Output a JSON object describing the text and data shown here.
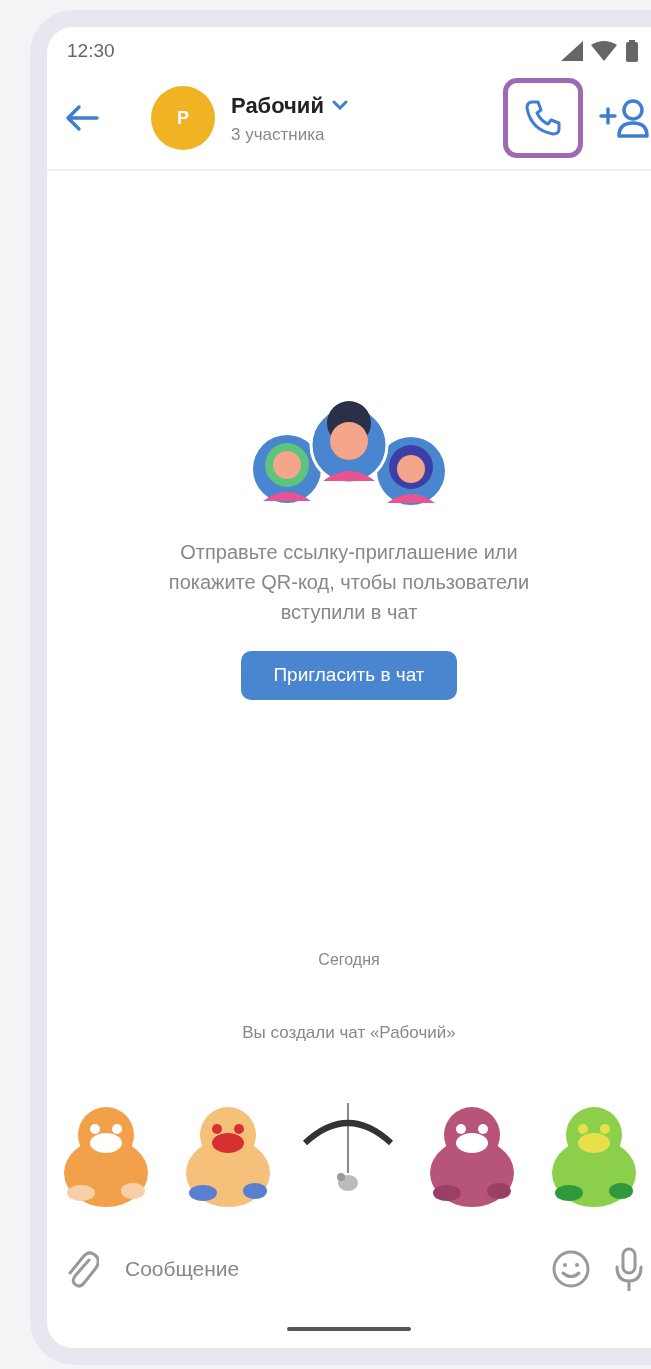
{
  "status_bar": {
    "time": "12:30"
  },
  "header": {
    "avatar_letter": "Р",
    "title": "Рабочий",
    "subtitle": "3 участника",
    "call_highlighted": true
  },
  "invite": {
    "text": "Отправьте ссылку-приглашение или покажите QR-код, чтобы пользователи вступили в чат",
    "button": "Пригласить в чат"
  },
  "messages": [
    {
      "kind": "date",
      "text": "Сегодня"
    },
    {
      "kind": "service",
      "text": "Вы создали чат «Рабочий»"
    }
  ],
  "composer": {
    "placeholder": "Сообщение"
  }
}
